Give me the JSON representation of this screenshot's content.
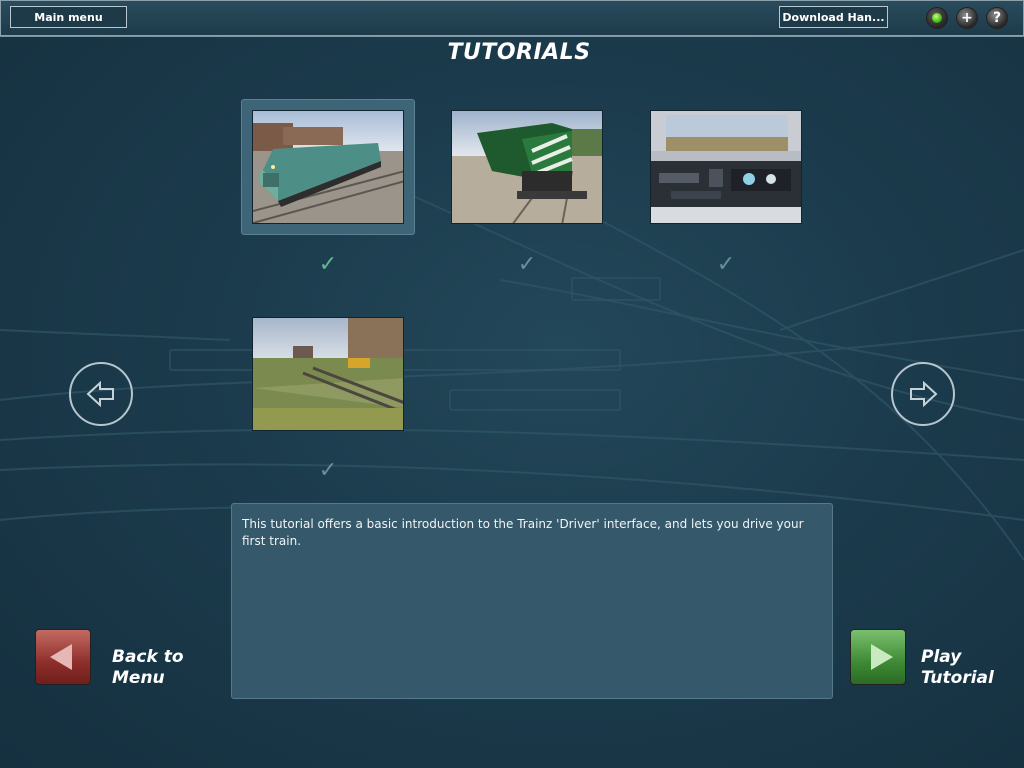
{
  "topbar": {
    "main_menu_label": "Main menu",
    "download_label": "Download Han...",
    "add_symbol": "+",
    "help_symbol": "?"
  },
  "page": {
    "title": "TUTORIALS"
  },
  "tutorials": [
    {
      "scene": "teal-locomotive-yard",
      "completed": true,
      "selected": true
    },
    {
      "scene": "green-locomotive-front",
      "completed": true,
      "selected": false
    },
    {
      "scene": "cab-interior-view",
      "completed": true,
      "selected": false
    },
    {
      "scene": "rail-yard-overview",
      "completed": true,
      "selected": false
    }
  ],
  "check_symbol": "✓",
  "navigation": {
    "prev_icon": "arrow-left-icon",
    "next_icon": "arrow-right-icon"
  },
  "description": {
    "text": "This tutorial offers a basic introduction to the Trainz 'Driver' interface, and lets you drive your first train."
  },
  "actions": {
    "back_label_line1": "Back to",
    "back_label_line2": "Menu",
    "play_label_line1": "Play",
    "play_label_line2": "Tutorial"
  },
  "colors": {
    "background": "#1b3b4c",
    "check_active": "#5fb88e",
    "back_button": "#8f2f2b",
    "play_button": "#3e8a34",
    "status_led": "#3fbf16"
  }
}
